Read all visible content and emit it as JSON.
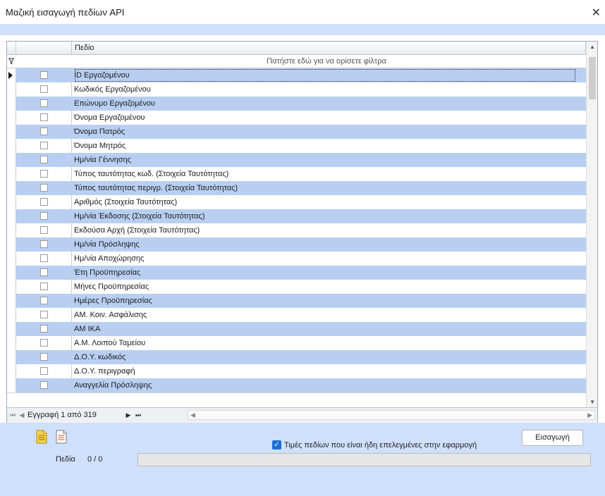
{
  "window": {
    "title": "Μαζική εισαγωγή πεδίων API",
    "close_glyph": "✕"
  },
  "grid": {
    "column_header": "Πεδίο",
    "filter_placeholder": "Πατήστε εδώ για να ορίσετε φίλτρα",
    "selected_row_index": 0,
    "rows": [
      {
        "label": "ID Εργαζομένου",
        "checked": false
      },
      {
        "label": "Κωδικός Εργαζομένου",
        "checked": false
      },
      {
        "label": "Επώνυμο Εργαζομένου",
        "checked": false
      },
      {
        "label": "Όνομα Εργαζομένου",
        "checked": false
      },
      {
        "label": "Όνομα Πατρός",
        "checked": false
      },
      {
        "label": "Όνομα Μητρός",
        "checked": false
      },
      {
        "label": "Ημ/νία Γέννησης",
        "checked": false
      },
      {
        "label": "Τύπος ταυτότητας κωδ. (Στοιχεία Ταυτότητας)",
        "checked": false
      },
      {
        "label": "Τύπος ταυτότητας περιγρ. (Στοιχεία Ταυτότητας)",
        "checked": false
      },
      {
        "label": "Αριθμός (Στοιχεία Ταυτότητας)",
        "checked": false
      },
      {
        "label": "Ημ/νία Έκδοσης (Στοιχεία Ταυτότητας)",
        "checked": false
      },
      {
        "label": "Εκδούσα Αρχή (Στοιχεία Ταυτότητας)",
        "checked": false
      },
      {
        "label": "Ημ/νία Πρόσληψης",
        "checked": false
      },
      {
        "label": "Ημ/νία Αποχώρησης",
        "checked": false
      },
      {
        "label": "Έτη Προϋπηρεσίας",
        "checked": false
      },
      {
        "label": "Μήνες Προϋπηρεσίας",
        "checked": false
      },
      {
        "label": "Ημέρες Προϋπηρεσίας",
        "checked": false
      },
      {
        "label": "ΑΜ. Κοιν. Ασφάλισης",
        "checked": false
      },
      {
        "label": "ΑΜ ΙΚΑ",
        "checked": false
      },
      {
        "label": "Α.Μ. Λοιπού Ταμείου",
        "checked": false
      },
      {
        "label": "Δ.Ο.Υ. κωδικός",
        "checked": false
      },
      {
        "label": "Δ.Ο.Υ. περιγραφή",
        "checked": false
      },
      {
        "label": "Αναγγελία Πρόσληψης",
        "checked": false
      }
    ],
    "navigator": {
      "record_text": "Εγγραφή 1 από 319",
      "first": "⏮",
      "prev": "◀",
      "next": "▶",
      "last": "⏭"
    }
  },
  "footer": {
    "icons": [
      "document-yellow-icon",
      "document-lines-icon"
    ],
    "option_label": "Τιμές πεδίων που είναι ήδη επελεγμένες στην εφαρμογή",
    "option_checked": true,
    "import_button": "Εισαγωγή",
    "fields_label": "Πεδία",
    "fields_count": "0  /  0",
    "progress": 0
  },
  "colors": {
    "accent": "#cfe0fb",
    "row_alt": "#b8cff2",
    "checkbox_blue": "#1f6fd1"
  }
}
